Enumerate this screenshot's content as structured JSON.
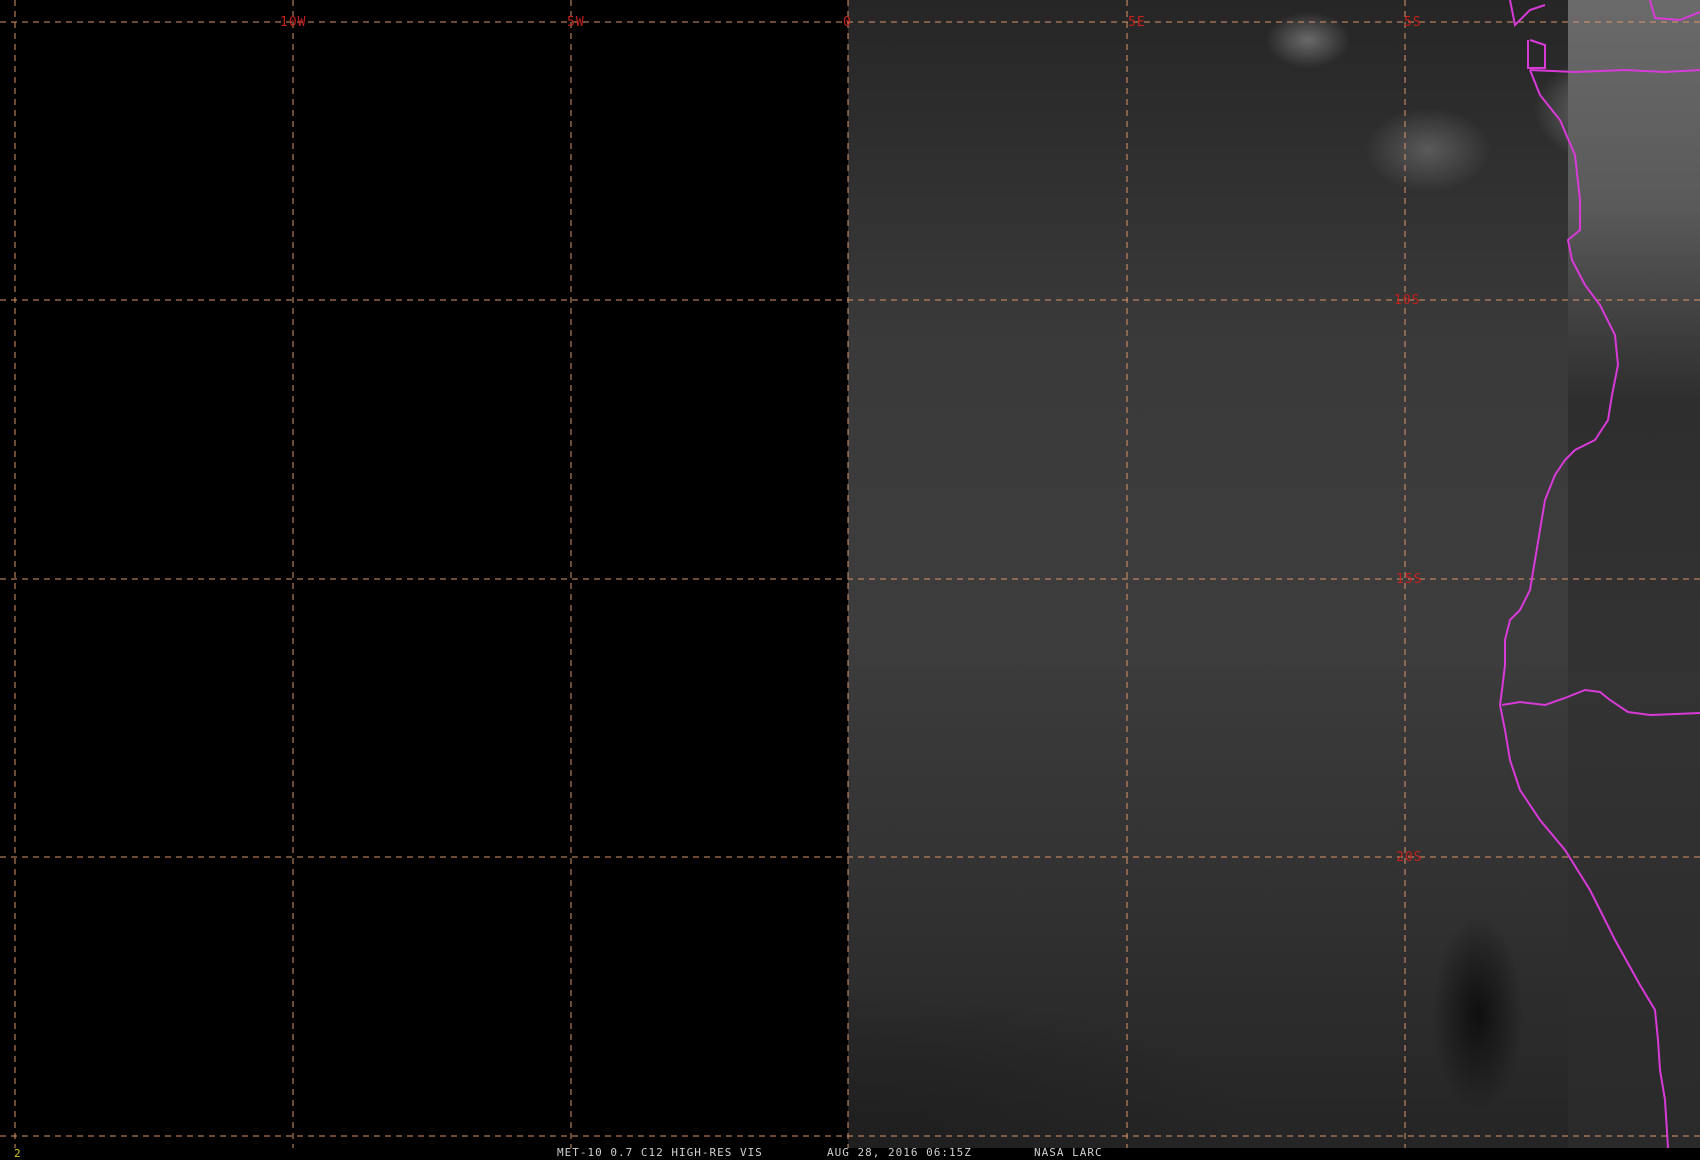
{
  "caption": {
    "product": "MET-10 0.7 C12 HIGH-RES VIS",
    "datetime": "AUG 28, 2016 06:15Z",
    "source": "NASA LARC"
  },
  "frame_number": "2",
  "longitude_labels": [
    "10W",
    "5W",
    "0",
    "5E",
    "5S"
  ],
  "latitude_labels": [
    "10S",
    "15S",
    "20S"
  ],
  "colors": {
    "grid": "#d9966a",
    "labels": "#c4201c",
    "boundaries": "#d83ad8",
    "frame_number": "#d8c820"
  }
}
